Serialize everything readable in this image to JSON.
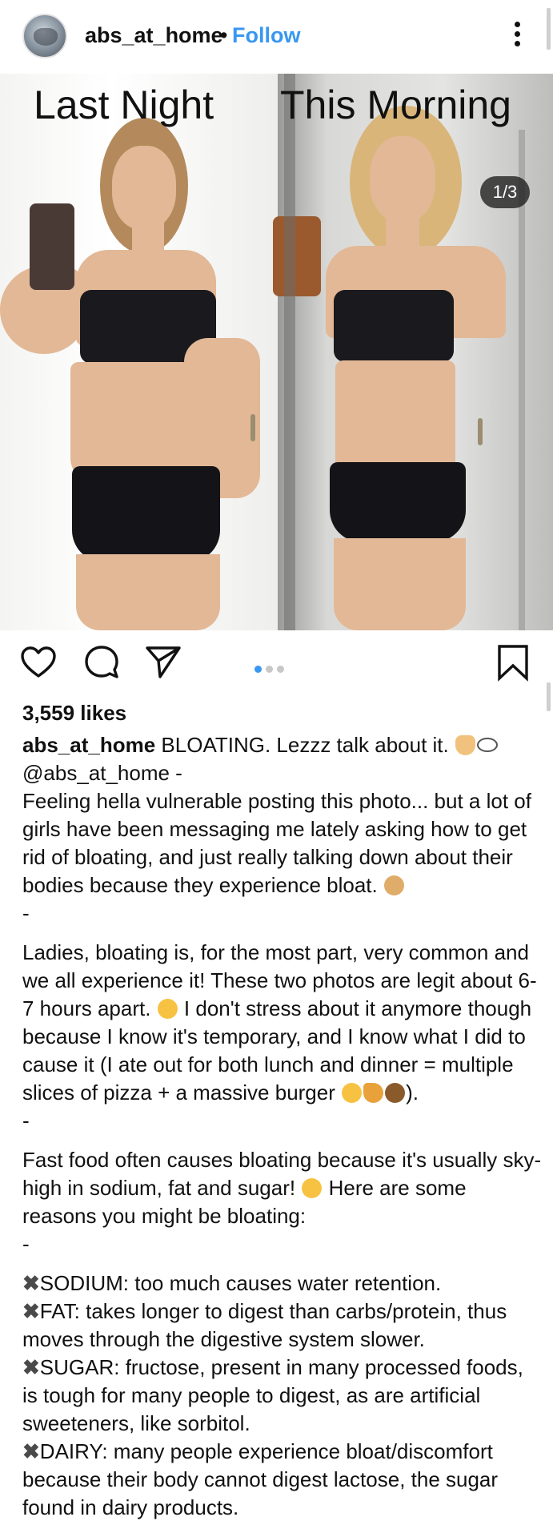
{
  "header": {
    "username": "abs_at_home",
    "separator": "•",
    "follow_label": "Follow"
  },
  "photo": {
    "left_label": "Last Night",
    "right_label": "This Morning",
    "counter": "1/3"
  },
  "post": {
    "likes": "3,559 likes",
    "caption_user": "abs_at_home",
    "caption_head": "BLOATING. Lezzz talk about it.",
    "mention": "@abs_at_home -",
    "p1": "Feeling hella vulnerable posting this photo... but a lot of girls have been messaging me lately asking how to get rid of bloating, and just really talking down about their bodies because they experience bloat.",
    "sep1": "-",
    "p2a": "Ladies, bloating is, for the most part, very common and we all experience it! These two photos are legit about 6-7 hours apart.",
    "p2b": "I don't stress about it anymore though because I know it's temporary, and I know what I did to cause it (I ate out for both lunch and dinner = multiple slices of pizza + a massive burger",
    "p2c": ").",
    "sep2": "-",
    "p3a": "Fast food often causes bloating because it's usually sky-high in sodium, fat and sugar!",
    "p3b": "Here are some reasons you might be bloating:",
    "sep3": "-",
    "reason1": "SODIUM: too much causes water retention.",
    "reason2": "FAT: takes longer to digest than carbs/protein, thus moves through the digestive system slower.",
    "reason3": "SUGAR: fructose, present in many processed foods, is tough for many people to digest, as are artificial sweeteners, like sorbitol.",
    "reason4": "DAIRY: many people experience bloat/discomfort because their body cannot digest lactose, the sugar found in dairy products.",
    "x_mark": "✖"
  },
  "icons": {
    "more": "more-options-icon",
    "heart": "heart-icon",
    "comment": "comment-icon",
    "share": "share-icon",
    "save": "bookmark-icon"
  },
  "colors": {
    "accent": "#3897f0",
    "text": "#111111"
  }
}
